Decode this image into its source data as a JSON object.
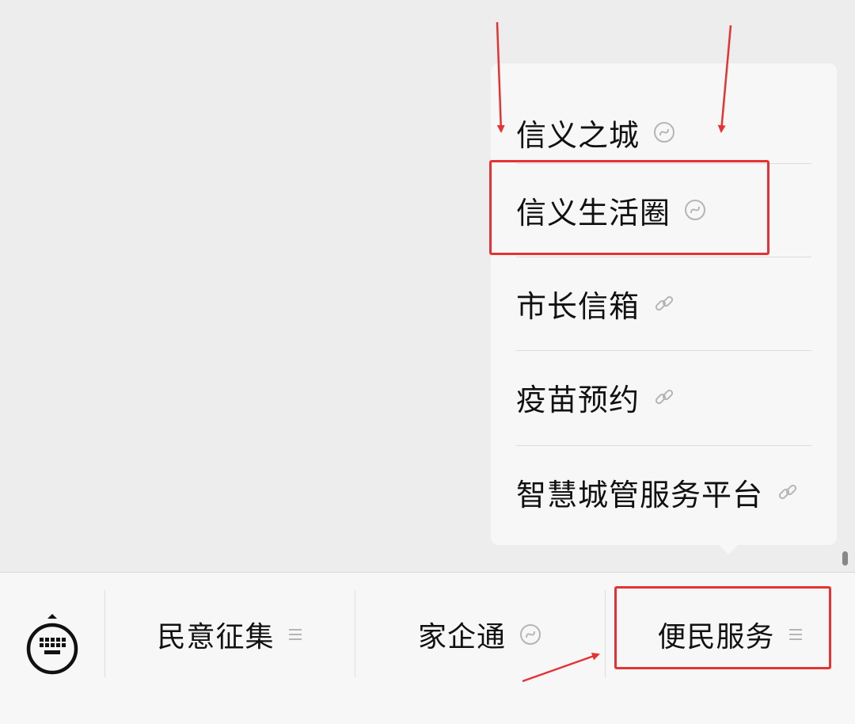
{
  "popup_menu": {
    "items": [
      {
        "label": "信义之城",
        "icon": "mini-program-icon"
      },
      {
        "label": "信义生活圈",
        "icon": "mini-program-icon"
      },
      {
        "label": "市长信箱",
        "icon": "link-icon"
      },
      {
        "label": "疫苗预约",
        "icon": "link-icon"
      },
      {
        "label": "智慧城管服务平台",
        "icon": "link-icon"
      }
    ]
  },
  "bottom_bar": {
    "keyboard_icon": "keyboard-icon",
    "tabs": [
      {
        "label": "民意征集",
        "icon": "menu-lines-icon"
      },
      {
        "label": "家企通",
        "icon": "mini-program-icon"
      },
      {
        "label": "便民服务",
        "icon": "menu-lines-icon"
      }
    ]
  },
  "annotations": {
    "color": "#e53232"
  }
}
